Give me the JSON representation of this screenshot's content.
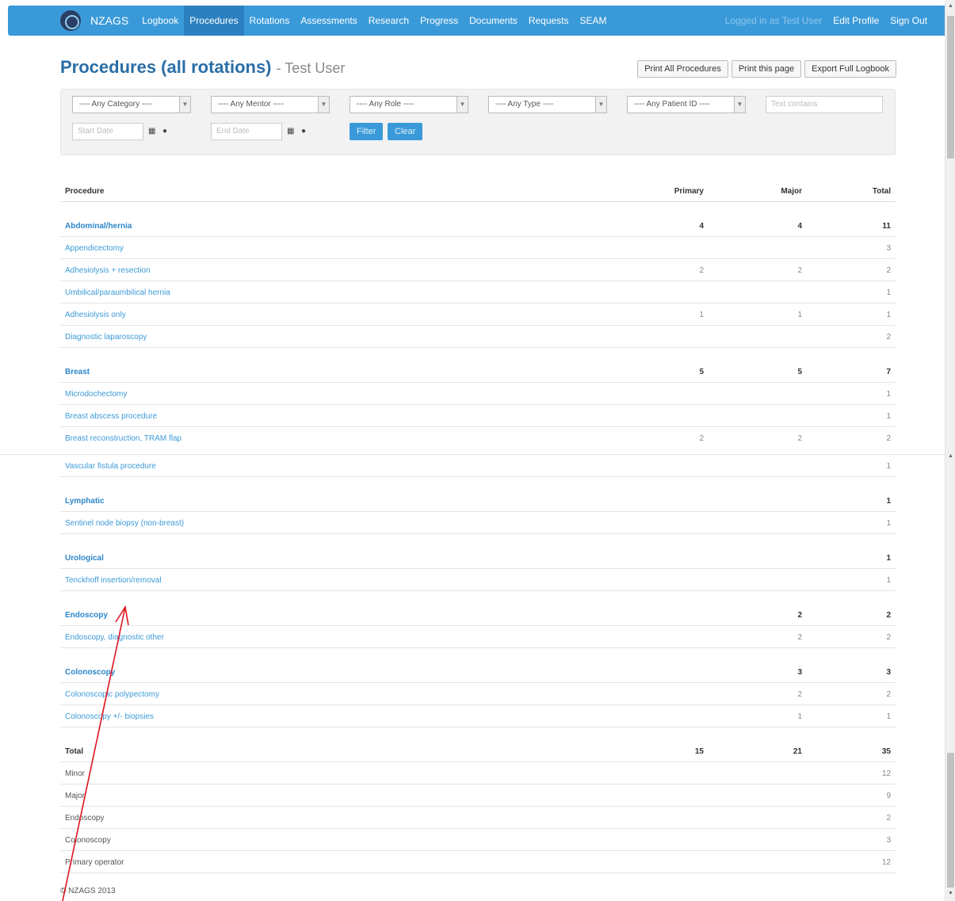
{
  "navbar": {
    "brand": "NZAGS",
    "items": [
      {
        "label": "Logbook"
      },
      {
        "label": "Procedures"
      },
      {
        "label": "Rotations"
      },
      {
        "label": "Assessments"
      },
      {
        "label": "Research"
      },
      {
        "label": "Progress"
      },
      {
        "label": "Documents"
      },
      {
        "label": "Requests"
      },
      {
        "label": "SEAM"
      }
    ],
    "active_index": 1,
    "logged_in": "Logged in as Test User",
    "edit_profile": "Edit Profile",
    "sign_out": "Sign Out"
  },
  "page": {
    "title": "Procedures (all rotations)",
    "subtitle": "- Test User",
    "buttons": {
      "print_all": "Print All Procedures",
      "print_page": "Print this page",
      "export": "Export Full Logbook"
    }
  },
  "filters": {
    "category": "---- Any Category ----",
    "mentor": "---- Any Mentor ----",
    "role": "---- Any Role ----",
    "type": "---- Any Type ----",
    "patient": "---- Any Patient ID ----",
    "text_placeholder": "Text contains",
    "start_placeholder": "Start Date",
    "end_placeholder": "End Date",
    "filter_label": "Filter",
    "clear_label": "Clear"
  },
  "table": {
    "headers": {
      "procedure": "Procedure",
      "primary": "Primary",
      "major": "Major",
      "total": "Total"
    },
    "rows_top": [
      {
        "kind": "cat",
        "name": "Abdominal/hernia",
        "primary": "4",
        "major": "4",
        "total": "11"
      },
      {
        "kind": "proc",
        "name": "Appendicectomy",
        "primary": "",
        "major": "",
        "total": "3"
      },
      {
        "kind": "proc",
        "name": "Adhesiolysis + resection",
        "primary": "2",
        "major": "2",
        "total": "2"
      },
      {
        "kind": "proc",
        "name": "Umbilical/paraumbilical hernia",
        "primary": "",
        "major": "",
        "total": "1"
      },
      {
        "kind": "proc",
        "name": "Adhesiolysis only",
        "primary": "1",
        "major": "1",
        "total": "1"
      },
      {
        "kind": "proc",
        "name": "Diagnostic laparoscopy",
        "primary": "",
        "major": "",
        "total": "2"
      },
      {
        "kind": "cat",
        "name": "Breast",
        "primary": "5",
        "major": "5",
        "total": "7"
      },
      {
        "kind": "proc",
        "name": "Microdochectomy",
        "primary": "",
        "major": "",
        "total": "1"
      },
      {
        "kind": "proc",
        "name": "Breast abscess procedure",
        "primary": "",
        "major": "",
        "total": "1"
      },
      {
        "kind": "proc",
        "name": "Breast reconstruction, TRAM flap",
        "primary": "2",
        "major": "2",
        "total": "2"
      }
    ],
    "rows_bottom": [
      {
        "kind": "proc",
        "name": "Vascular fistula procedure",
        "primary": "",
        "major": "",
        "total": "1"
      },
      {
        "kind": "cat",
        "name": "Lymphatic",
        "primary": "",
        "major": "",
        "total": "1"
      },
      {
        "kind": "proc",
        "name": "Sentinel node biopsy (non-breast)",
        "primary": "",
        "major": "",
        "total": "1"
      },
      {
        "kind": "cat",
        "name": "Urological",
        "primary": "",
        "major": "",
        "total": "1"
      },
      {
        "kind": "proc",
        "name": "Tenckhoff insertion/removal",
        "primary": "",
        "major": "",
        "total": "1"
      },
      {
        "kind": "cat",
        "name": "Endoscopy",
        "primary": "",
        "major": "2",
        "total": "2"
      },
      {
        "kind": "proc",
        "name": "Endoscopy, diagnostic other",
        "primary": "",
        "major": "2",
        "total": "2"
      },
      {
        "kind": "cat",
        "name": "Colonoscopy",
        "primary": "",
        "major": "3",
        "total": "3"
      },
      {
        "kind": "proc",
        "name": "Colonoscopic polypectomy",
        "primary": "",
        "major": "2",
        "total": "2"
      },
      {
        "kind": "proc",
        "name": "Colonoscopy +/- biopsies",
        "primary": "",
        "major": "1",
        "total": "1"
      },
      {
        "kind": "cat tot",
        "name": "Total",
        "primary": "15",
        "major": "21",
        "total": "35"
      },
      {
        "kind": "proc sum",
        "name": "Minor",
        "primary": "",
        "major": "",
        "total": "12"
      },
      {
        "kind": "proc sum",
        "name": "Major",
        "primary": "",
        "major": "",
        "total": "9"
      },
      {
        "kind": "proc sum",
        "name": "Endoscopy",
        "primary": "",
        "major": "",
        "total": "2"
      },
      {
        "kind": "proc sum",
        "name": "Colonoscopy",
        "primary": "",
        "major": "",
        "total": "3"
      },
      {
        "kind": "proc sum",
        "name": "Primary operator",
        "primary": "",
        "major": "",
        "total": "12"
      }
    ]
  },
  "footer": "© NZAGS 2013",
  "colors": {
    "navbar": "#3a9ad9",
    "link": "#3d9bd8",
    "annotation_arrow": "#e0141e"
  }
}
